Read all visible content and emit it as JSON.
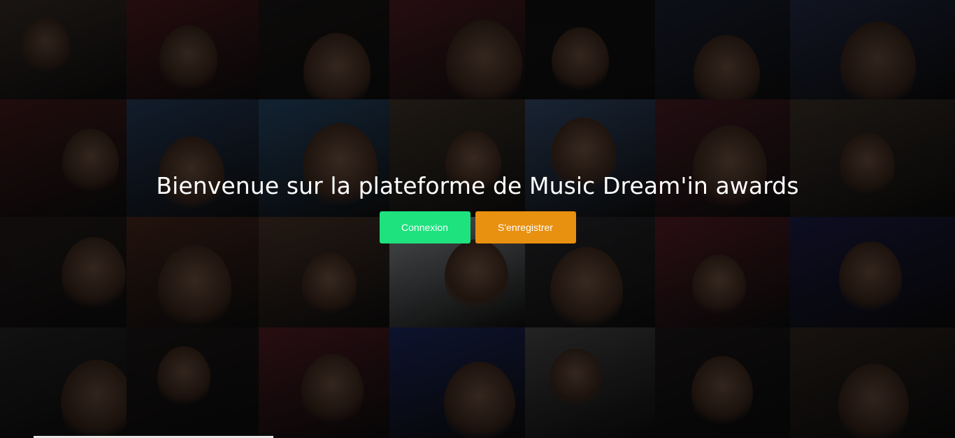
{
  "hero": {
    "title": "Bienvenue sur la plateforme de Music Dream'in awards"
  },
  "actions": {
    "login_label": "Connexion",
    "register_label": "S'enregistrer"
  },
  "colors": {
    "login_button": "#1de27e",
    "register_button": "#e8900f",
    "title_text": "#ffffff"
  },
  "background": {
    "description_icon": "photo-mosaic",
    "tile_colors": [
      "#5a4a40",
      "#7a2a30",
      "#2a2522",
      "#7a2c36",
      "#1c1a1a",
      "#2c3450",
      "#3a4470",
      "#6a2a2c",
      "#3a5a8a",
      "#3a6a9a",
      "#5a4a3a",
      "#4a6a9a",
      "#6a2a36",
      "#5a4a3e",
      "#3a2a2a",
      "#6a3a2a",
      "#6a4a3a",
      "#cfd6dc",
      "#3a3a40",
      "#7a2a36",
      "#2a2a6a",
      "#3a3a3a",
      "#2a2222",
      "#7a2a36",
      "#2a3a8a",
      "#6a6a6a",
      "#2a2424",
      "#4a3a30"
    ]
  }
}
